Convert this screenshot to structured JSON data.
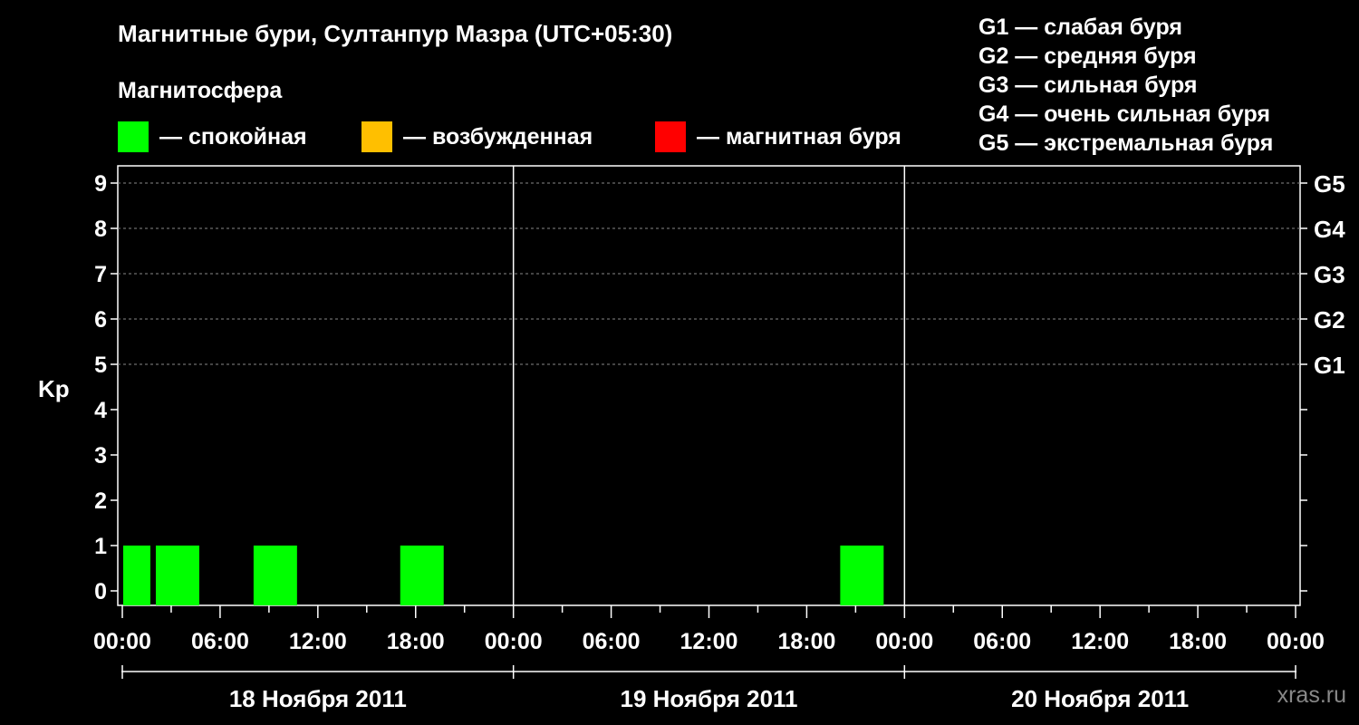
{
  "title": "Магнитные бури, Султанпур Мазра (UTC+05:30)",
  "subtitle": "Магнитосфера",
  "legend": [
    {
      "label": "— спокойная",
      "color": "#00ff00"
    },
    {
      "label": "— возбужденная",
      "color": "#ffbf00"
    },
    {
      "label": "— магнитная буря",
      "color": "#ff0000"
    }
  ],
  "g_scale": [
    "G1 — слабая буря",
    "G2 — средняя буря",
    "G3 — сильная буря",
    "G4 — очень сильная буря",
    "G5 — экстремальная буря"
  ],
  "watermark": "xras.ru",
  "chart_data": {
    "type": "bar",
    "ylabel": "Kp",
    "ylim": [
      0,
      9
    ],
    "yticks": [
      "0",
      "1",
      "2",
      "3",
      "4",
      "5",
      "6",
      "7",
      "8",
      "9"
    ],
    "right_ticks": [
      {
        "kp": 5,
        "label": "G1"
      },
      {
        "kp": 6,
        "label": "G2"
      },
      {
        "kp": 7,
        "label": "G3"
      },
      {
        "kp": 8,
        "label": "G4"
      },
      {
        "kp": 9,
        "label": "G5"
      }
    ],
    "xlim_hours": [
      0,
      72
    ],
    "xtick_labels": [
      "00:00",
      "06:00",
      "12:00",
      "18:00",
      "00:00",
      "06:00",
      "12:00",
      "18:00",
      "00:00",
      "06:00",
      "12:00",
      "18:00",
      "00:00"
    ],
    "days": [
      "18 Ноября 2011",
      "19 Ноября 2011",
      "20 Ноября 2011"
    ],
    "grid": "dashed horizontal at Kp 5–9",
    "bars": [
      {
        "start": "18 Ноября 2011 00:00",
        "end": "18 Ноября 2011 02:00",
        "kp": 1,
        "level": "спокойная"
      },
      {
        "start": "18 Ноября 2011 02:00",
        "end": "18 Ноября 2011 05:00",
        "kp": 1,
        "level": "спокойная"
      },
      {
        "start": "18 Ноября 2011 08:00",
        "end": "18 Ноября 2011 11:00",
        "kp": 1,
        "level": "спокойная"
      },
      {
        "start": "18 Ноября 2011 17:00",
        "end": "18 Ноября 2011 20:00",
        "kp": 1,
        "level": "спокойная"
      },
      {
        "start": "19 Ноября 2011 20:00",
        "end": "19 Ноября 2011 23:00",
        "kp": 1,
        "level": "спокойная"
      }
    ]
  }
}
